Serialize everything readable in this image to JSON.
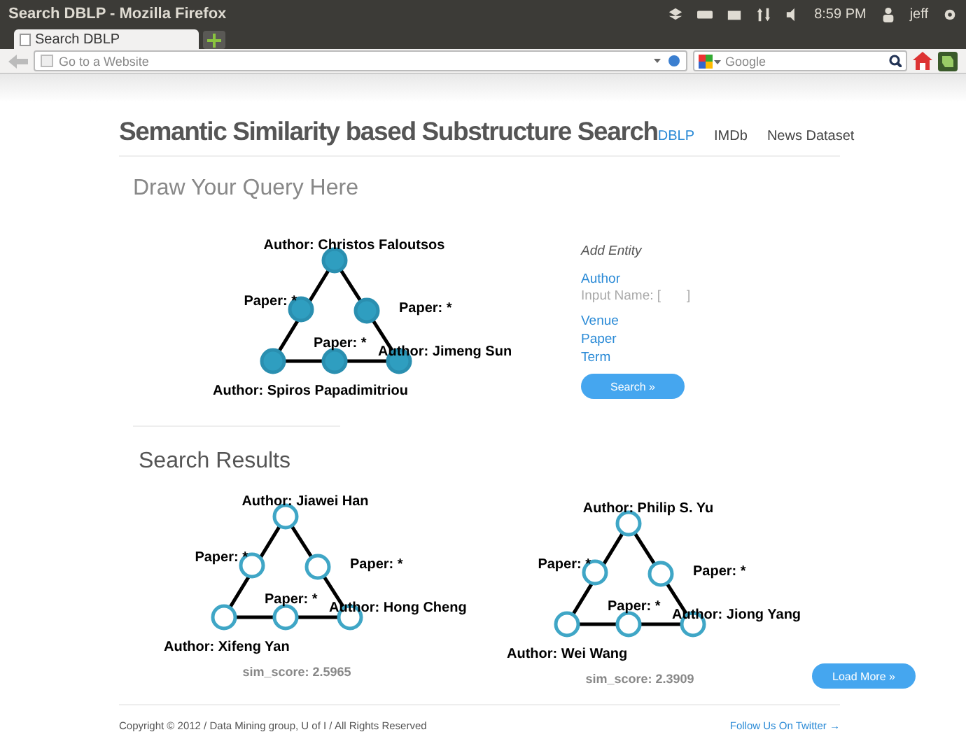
{
  "window": {
    "title": "Search DBLP - Mozilla Firefox",
    "clock": "8:59 PM",
    "user": "jeff"
  },
  "tabs": [
    {
      "label": "Search DBLP",
      "selected": true
    }
  ],
  "address_bar": {
    "placeholder": "Go to a Website"
  },
  "search_bar": {
    "placeholder": "Google"
  },
  "header": {
    "title": "Semantic Similarity based Substructure Search",
    "nav": [
      {
        "label": "DBLP",
        "selected": true
      },
      {
        "label": "IMDb",
        "selected": false
      },
      {
        "label": "News Dataset",
        "selected": false
      }
    ]
  },
  "query": {
    "heading": "Draw Your Query Here",
    "graph": {
      "kind": "query",
      "nodes": [
        "Author: Christos Faloutsos",
        "Paper: *",
        "Paper: *",
        "Paper: *",
        "Author: Jimeng Sun",
        "Author: Spiros Papadimitriou"
      ]
    },
    "add_entity": {
      "heading": "Add Entity",
      "author": "Author",
      "input_name": "Input Name: [       ]",
      "options": [
        "Venue",
        "Paper",
        "Term"
      ]
    },
    "search_button": "Search »"
  },
  "results": {
    "heading": "Search Results",
    "graphs": [
      {
        "kind": "result",
        "nodes": [
          "Author: Jiawei Han",
          "Paper: *",
          "Paper: *",
          "Paper: *",
          "Author: Hong Cheng",
          "Author: Xifeng Yan"
        ],
        "sim_score": "sim_score: 2.5965"
      },
      {
        "kind": "result",
        "nodes": [
          "Author: Philip S. Yu",
          "Paper: *",
          "Paper: *",
          "Paper: *",
          "Author: Jiong Yang",
          "Author: Wei Wang"
        ],
        "sim_score": "sim_score: 2.3909"
      }
    ],
    "load_more": "Load More »"
  },
  "footer": {
    "copyright": "Copyright © 2012 / Data Mining group, U of I / All Rights Reserved",
    "twitter": "Follow Us On Twitter →"
  }
}
